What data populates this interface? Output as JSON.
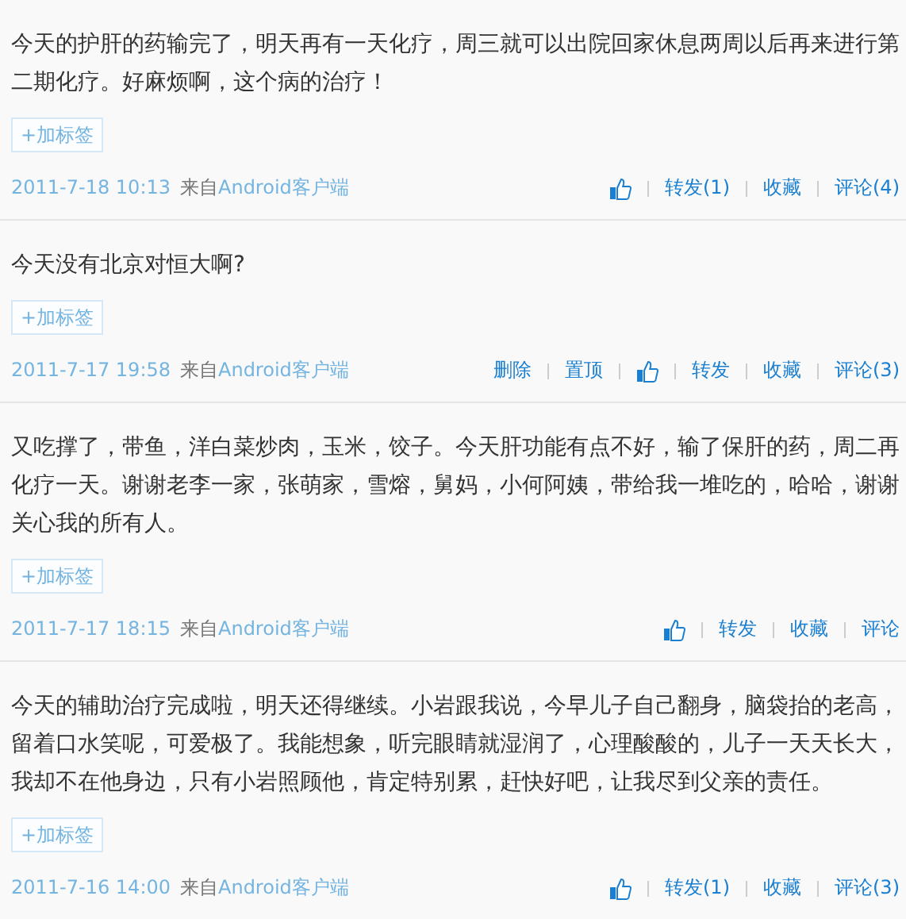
{
  "posts": [
    {
      "text": "今天的护肝的药输完了，明天再有一天化疗，周三就可以出院回家休息两周以后再来进行第二期化疗。好麻烦啊，这个病的治疗！",
      "tag_button": "+加标签",
      "time": "2011-7-18 10:13",
      "source_prefix": "来自",
      "source": "Android客户端",
      "actions": [
        {
          "kind": "like"
        },
        {
          "kind": "link",
          "label": "转发(1)"
        },
        {
          "kind": "link",
          "label": "收藏"
        },
        {
          "kind": "link",
          "label": "评论(4)"
        }
      ]
    },
    {
      "text": "今天没有北京对恒大啊?",
      "tag_button": "+加标签",
      "time": "2011-7-17 19:58",
      "source_prefix": "来自",
      "source": "Android客户端",
      "actions": [
        {
          "kind": "link",
          "label": "删除"
        },
        {
          "kind": "link",
          "label": "置顶"
        },
        {
          "kind": "like"
        },
        {
          "kind": "link",
          "label": "转发"
        },
        {
          "kind": "link",
          "label": "收藏"
        },
        {
          "kind": "link",
          "label": "评论(3)"
        }
      ]
    },
    {
      "text": "又吃撑了，带鱼，洋白菜炒肉，玉米，饺子。今天肝功能有点不好，输了保肝的药，周二再化疗一天。谢谢老李一家，张萌家，雪熔，舅妈，小何阿姨，带给我一堆吃的，哈哈，谢谢关心我的所有人。",
      "tag_button": "+加标签",
      "time": "2011-7-17 18:15",
      "source_prefix": "来自",
      "source": "Android客户端",
      "actions": [
        {
          "kind": "like"
        },
        {
          "kind": "link",
          "label": "转发"
        },
        {
          "kind": "link",
          "label": "收藏"
        },
        {
          "kind": "link",
          "label": "评论"
        }
      ]
    },
    {
      "text": "今天的辅助治疗完成啦，明天还得继续。小岩跟我说，今早儿子自己翻身，脑袋抬的老高，留着口水笑呢，可爱极了。我能想象，听完眼睛就湿润了，心理酸酸的，儿子一天天长大，我却不在他身边，只有小岩照顾他，肯定特别累，赶快好吧，让我尽到父亲的责任。",
      "tag_button": "+加标签",
      "time": "2011-7-16 14:00",
      "source_prefix": "来自",
      "source": "Android客户端",
      "actions": [
        {
          "kind": "like"
        },
        {
          "kind": "link",
          "label": "转发(1)"
        },
        {
          "kind": "link",
          "label": "收藏"
        },
        {
          "kind": "link",
          "label": "评论(3)"
        }
      ]
    }
  ]
}
